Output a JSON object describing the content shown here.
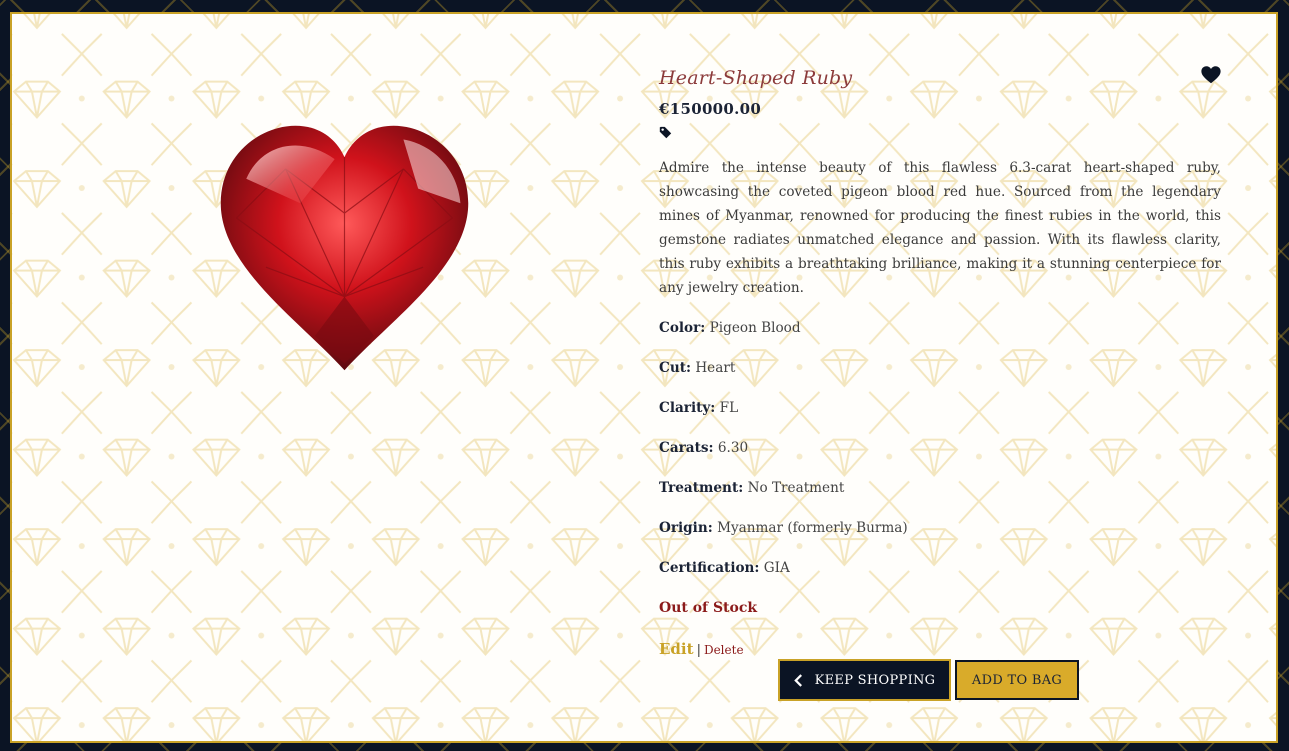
{
  "product": {
    "title": "Heart-Shaped Ruby",
    "price": "€150000.00",
    "description": "Admire the intense beauty of this flawless 6.3-carat heart-shaped ruby, showcasing the coveted pigeon blood red hue. Sourced from the legendary mines of Myanmar, renowned for producing the finest rubies in the world, this gemstone radiates unmatched elegance and passion. With its flawless clarity, this ruby exhibits a breathtaking brilliance, making it a stunning centerpiece for any jewelry creation.",
    "stock_status": "Out of Stock"
  },
  "specs": [
    {
      "label": "Color:",
      "value": "Pigeon Blood"
    },
    {
      "label": "Cut:",
      "value": "Heart"
    },
    {
      "label": "Clarity:",
      "value": "FL"
    },
    {
      "label": "Carats:",
      "value": "6.30"
    },
    {
      "label": "Treatment:",
      "value": "No Treatment"
    },
    {
      "label": "Origin:",
      "value": "Myanmar (formerly Burma)"
    },
    {
      "label": "Certification:",
      "value": "GIA"
    }
  ],
  "admin": {
    "edit_label": "Edit",
    "separator": "|",
    "delete_label": "Delete"
  },
  "buttons": {
    "keep_shopping_label": "KEEP SHOPPING",
    "add_to_bag_label": "ADD TO BAG"
  },
  "icons": {
    "wishlist": "heart-icon",
    "tag": "tag-icon",
    "back": "chevron-left-icon"
  },
  "colors": {
    "navy": "#0b1424",
    "gold": "#c9a227",
    "ruby_red": "#c4161c",
    "title_red": "#8c3b3b",
    "stock_red": "#8b1a1a"
  }
}
